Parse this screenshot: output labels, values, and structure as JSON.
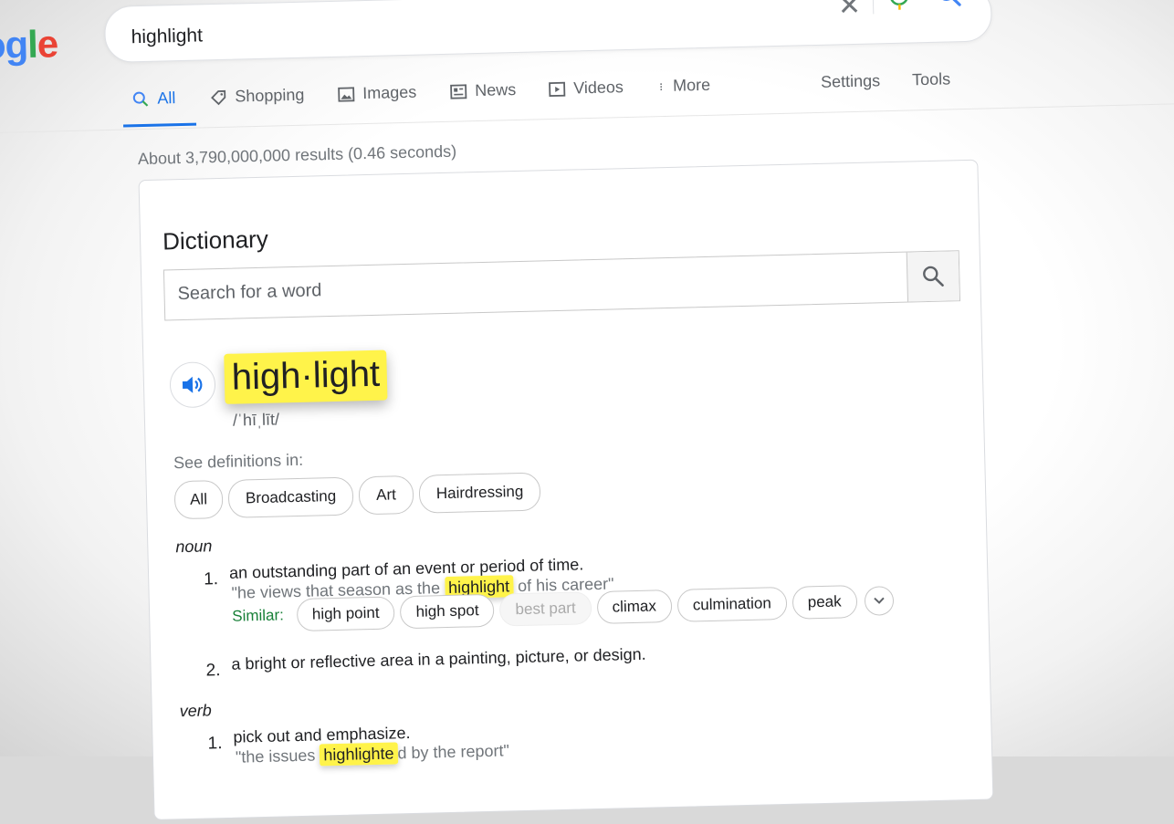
{
  "logo": {
    "part1": "o",
    "part2": "g",
    "part3": "l",
    "part4": "e"
  },
  "search": {
    "query": "highlight"
  },
  "tabs": [
    {
      "label": "All",
      "icon": "search-icon",
      "active": true
    },
    {
      "label": "Shopping",
      "icon": "tag-icon"
    },
    {
      "label": "Images",
      "icon": "image-icon"
    },
    {
      "label": "News",
      "icon": "news-icon"
    },
    {
      "label": "Videos",
      "icon": "video-icon"
    },
    {
      "label": "More",
      "icon": "more-vert-icon"
    }
  ],
  "tools": {
    "settings": "Settings",
    "tools": "Tools"
  },
  "stats": "About 3,790,000,000 results (0.46 seconds)",
  "dictionary": {
    "title": "Dictionary",
    "search_placeholder": "Search for a word",
    "headword": "high·light",
    "phonetic": "/ˈhīˌlīt/",
    "see_definitions": "See definitions in:",
    "domains": [
      "All",
      "Broadcasting",
      "Art",
      "Hairdressing"
    ],
    "noun_label": "noun",
    "noun_senses": [
      {
        "num": "1.",
        "definition": "an outstanding part of an event or period of time.",
        "example_pre": "\"he views that season as the ",
        "example_hl": "highlight",
        "example_post": " of his career\"",
        "similar_label": "Similar:",
        "similar": [
          "high point",
          "high spot",
          "best part",
          "climax",
          "culmination",
          "peak"
        ]
      },
      {
        "num": "2.",
        "definition": "a bright or reflective area in a painting, picture, or design."
      }
    ],
    "verb_label": "verb",
    "verb_senses": [
      {
        "num": "1.",
        "definition": "pick out and emphasize.",
        "example_pre": "\"the issues ",
        "example_hl": "highlighte",
        "example_post": "d by the report\""
      }
    ]
  },
  "colors": {
    "accent": "#1a73e8",
    "highlight": "#fff34a",
    "similar_label": "#188038"
  }
}
